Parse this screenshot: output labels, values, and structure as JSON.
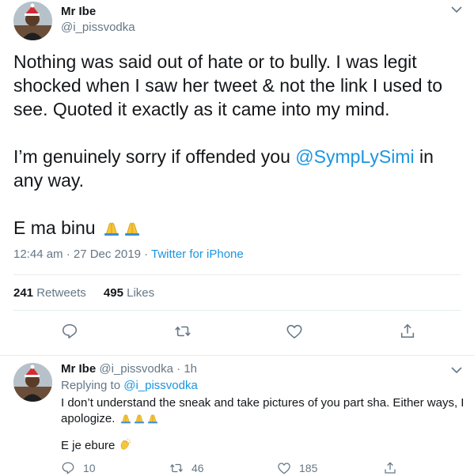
{
  "main_tweet": {
    "author": {
      "name": "Mr Ibe",
      "handle": "@i_pissvodka"
    },
    "lines": {
      "p1": "Nothing was said out of hate or to bully. I was legit shocked when I saw her tweet & not the link I used to see. Quoted it exactly as it came into my mind.",
      "p2_before": "I’m genuinely sorry if offended you ",
      "p2_mention": "@SympLySimi",
      "p2_after": " in any way.",
      "p3": "E ma binu"
    },
    "emojis": [
      "folded-hands",
      "folded-hands"
    ],
    "timestamp": "12:44 am · 27 Dec 2019",
    "separator": " · ",
    "client": "Twitter for iPhone",
    "stats": {
      "retweets_count": "241",
      "retweets_label": "Retweets",
      "likes_count": "495",
      "likes_label": "Likes"
    },
    "actions": [
      "reply-icon",
      "retweet-icon",
      "like-icon",
      "share-icon"
    ]
  },
  "reply_tweet": {
    "author": {
      "name": "Mr Ibe",
      "handle": "@i_pissvodka",
      "time": "1h",
      "dot": "·"
    },
    "replying_label": "Replying to",
    "replying_to": "@i_pissvodka",
    "text": "I don’t understand the sneak and take pictures of you part sha. Either ways, I apologize.",
    "text2": "E je ebure",
    "emojis": [
      "folded-hands",
      "folded-hands",
      "folded-hands",
      "clapping-hands"
    ],
    "counts": {
      "replies": "10",
      "retweets": "46",
      "likes": "185"
    }
  },
  "colors": {
    "accent": "#1b95e0",
    "muted": "#657786",
    "text": "#14171a",
    "border": "#e6ecf0"
  }
}
